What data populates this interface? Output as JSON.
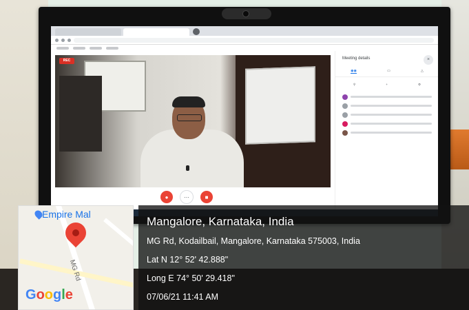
{
  "map": {
    "place_name": "Empire Mal",
    "road_name": "MG Rd",
    "logo_text": "Google",
    "logo_colors": [
      "#4285f4",
      "#ea4335",
      "#fbbc05",
      "#4285f4",
      "#34a853",
      "#ea4335"
    ]
  },
  "location": {
    "title": "Mangalore, Karnataka, India",
    "address": "MG Rd, Kodailbail, Mangalore, Karnataka 575003, India",
    "latitude": "Lat N 12° 52' 42.888\"",
    "longitude": "Long E 74° 50' 29.418\"",
    "datetime": "07/06/21 11:41 AM"
  },
  "meet": {
    "rec_badge": "REC",
    "side_title": "Meeting details"
  },
  "colors": {
    "meet_red": "#ea4335",
    "meet_blue": "#1a73e8",
    "overlay_bg": "#121212"
  }
}
